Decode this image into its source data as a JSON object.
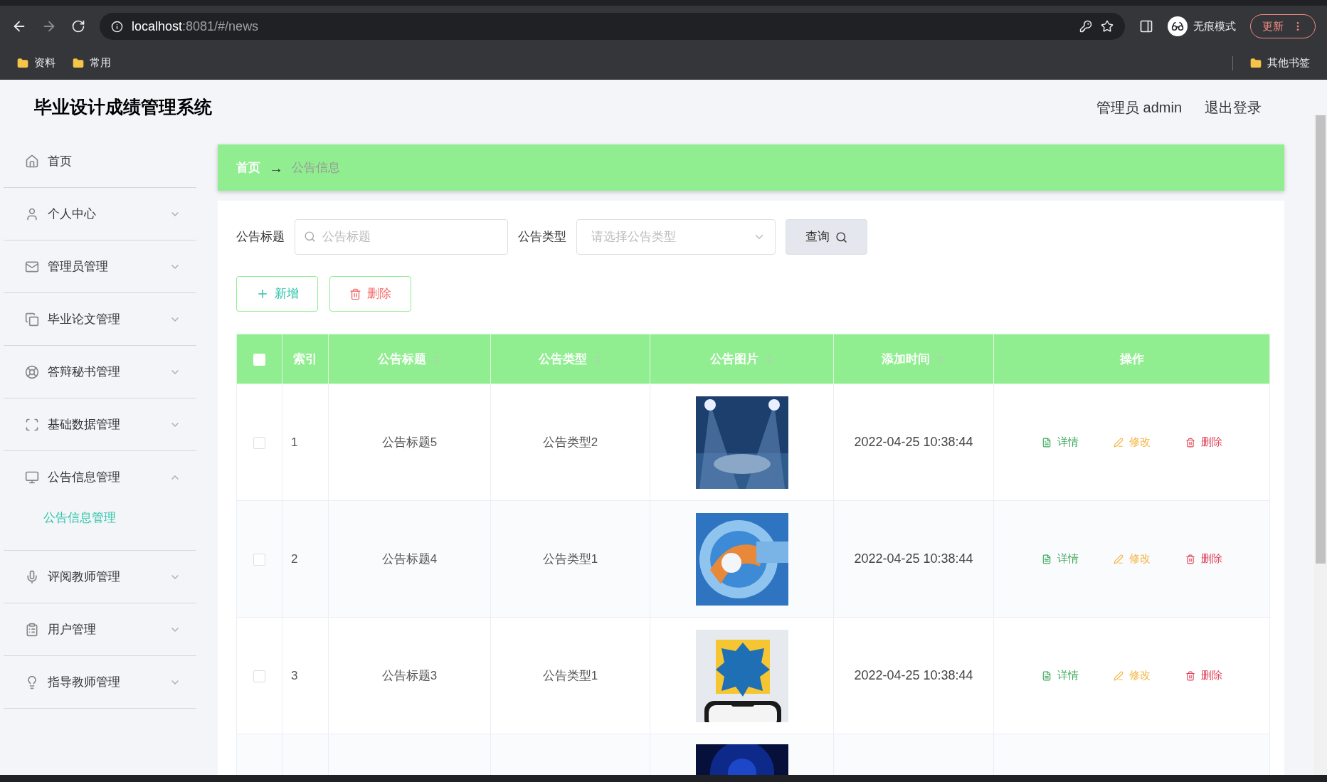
{
  "browser": {
    "url_host": "localhost",
    "url_rest": ":8081/#/news",
    "profile_label": "无痕模式",
    "update_button": "更新",
    "bookmarks": [
      {
        "label": "资料"
      },
      {
        "label": "常用"
      }
    ],
    "other_bookmarks": "其他书签"
  },
  "header": {
    "title": "毕业设计成绩管理系统",
    "user": "管理员 admin",
    "logout": "退出登录"
  },
  "sidebar": {
    "items": [
      {
        "label": "首页",
        "kind": "link"
      },
      {
        "label": "个人中心",
        "kind": "submenu",
        "expanded": false
      },
      {
        "label": "管理员管理",
        "kind": "submenu",
        "expanded": false
      },
      {
        "label": "毕业论文管理",
        "kind": "submenu",
        "expanded": false
      },
      {
        "label": "答辩秘书管理",
        "kind": "submenu",
        "expanded": false
      },
      {
        "label": "基础数据管理",
        "kind": "submenu",
        "expanded": false
      },
      {
        "label": "公告信息管理",
        "kind": "submenu",
        "expanded": true,
        "children": [
          {
            "label": "公告信息管理",
            "selected": true
          }
        ]
      },
      {
        "label": "评阅教师管理",
        "kind": "submenu",
        "expanded": false
      },
      {
        "label": "用户管理",
        "kind": "submenu",
        "expanded": false
      },
      {
        "label": "指导教师管理",
        "kind": "submenu",
        "expanded": false
      }
    ]
  },
  "breadcrumb": {
    "home": "首页",
    "separator": "→",
    "current": "公告信息"
  },
  "search": {
    "title_label": "公告标题",
    "title_placeholder": "公告标题",
    "type_label": "公告类型",
    "type_placeholder": "请选择公告类型",
    "query_button": "查询"
  },
  "actions": {
    "add": "新增",
    "delete": "删除"
  },
  "table": {
    "columns": [
      {
        "label": "索引",
        "sortable": false
      },
      {
        "label": "公告标题",
        "sortable": true
      },
      {
        "label": "公告类型",
        "sortable": true
      },
      {
        "label": "公告图片",
        "sortable": true
      },
      {
        "label": "添加时间",
        "sortable": true
      },
      {
        "label": "操作",
        "sortable": false
      }
    ],
    "select_all_checked": false,
    "rows": [
      {
        "index": "1",
        "title": "公告标题5",
        "type": "公告类型2",
        "kind": "picture",
        "time": "2022-04-25 10:38:44",
        "checked": false,
        "actions": [
          {
            "kind": "detail",
            "label": "详情"
          },
          {
            "kind": "edit",
            "label": "修改"
          },
          {
            "kind": "delete",
            "label": "删除"
          }
        ]
      },
      {
        "index": "2",
        "title": "公告标题4",
        "type": "公告类型1",
        "kind": "picture",
        "time": "2022-04-25 10:38:44",
        "checked": false,
        "actions": [
          {
            "kind": "detail",
            "label": "详情"
          },
          {
            "kind": "edit",
            "label": "修改"
          },
          {
            "kind": "delete",
            "label": "删除"
          }
        ]
      },
      {
        "index": "3",
        "title": "公告标题3",
        "type": "公告类型1",
        "kind": "picture",
        "time": "2022-04-25 10:38:44",
        "checked": false,
        "actions": [
          {
            "kind": "detail",
            "label": "详情"
          },
          {
            "kind": "edit",
            "label": "修改"
          },
          {
            "kind": "delete",
            "label": "删除"
          }
        ]
      },
      {
        "kind": "picture"
      }
    ]
  }
}
